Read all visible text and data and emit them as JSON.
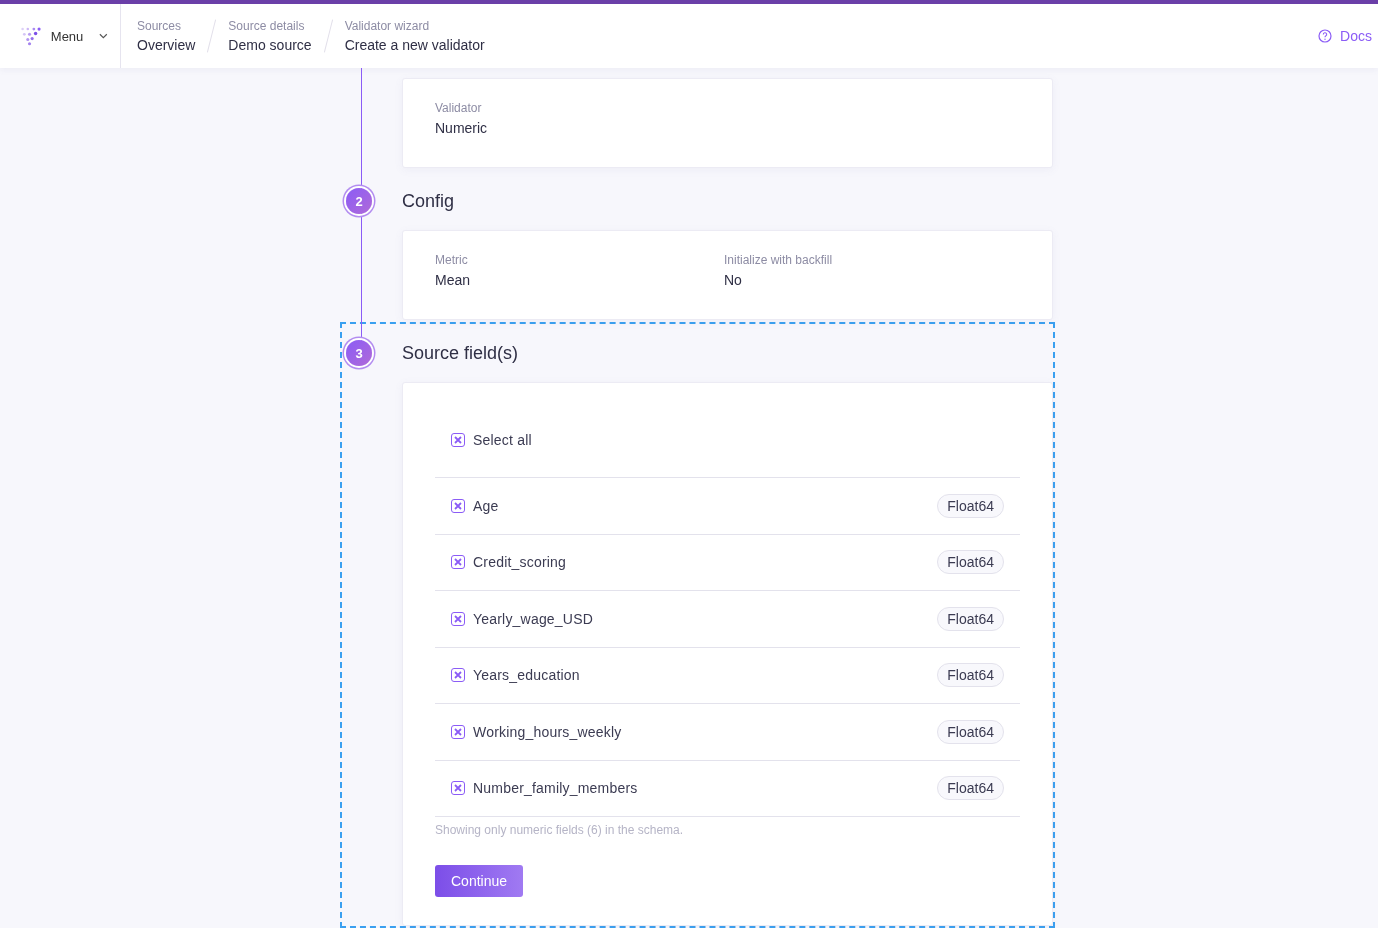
{
  "header": {
    "menu_label": "Menu",
    "breadcrumbs": [
      {
        "parent": "Sources",
        "current": "Overview"
      },
      {
        "parent": "Source details",
        "current": "Demo source"
      },
      {
        "parent": "Validator wizard",
        "current": "Create a new validator"
      }
    ],
    "docs_link": "Docs"
  },
  "steps": [
    {
      "kind": "summary",
      "active": false,
      "fields": [
        {
          "label": "Validator",
          "value": "Numeric"
        }
      ]
    },
    {
      "kind": "summary",
      "active": false,
      "number": "2",
      "title": "Config",
      "fields": [
        {
          "label": "Metric",
          "value": "Mean"
        },
        {
          "label": "Initialize with backfill",
          "value": "No"
        }
      ]
    },
    {
      "kind": "fields",
      "number": "3",
      "title": "Source field(s)",
      "active": true,
      "select_all": {
        "label": "Select all",
        "checked": true
      },
      "fields": [
        {
          "name": "Age",
          "type": "Float64",
          "checked": true
        },
        {
          "name": "Credit_scoring",
          "type": "Float64",
          "checked": true
        },
        {
          "name": "Yearly_wage_USD",
          "type": "Float64",
          "checked": true
        },
        {
          "name": "Years_education",
          "type": "Float64",
          "checked": true
        },
        {
          "name": "Working_hours_weekly",
          "type": "Float64",
          "checked": true
        },
        {
          "name": "Number_family_members",
          "type": "Float64",
          "checked": true
        }
      ],
      "note": "Showing only numeric fields (6) in the schema.",
      "button": "Continue"
    }
  ]
}
